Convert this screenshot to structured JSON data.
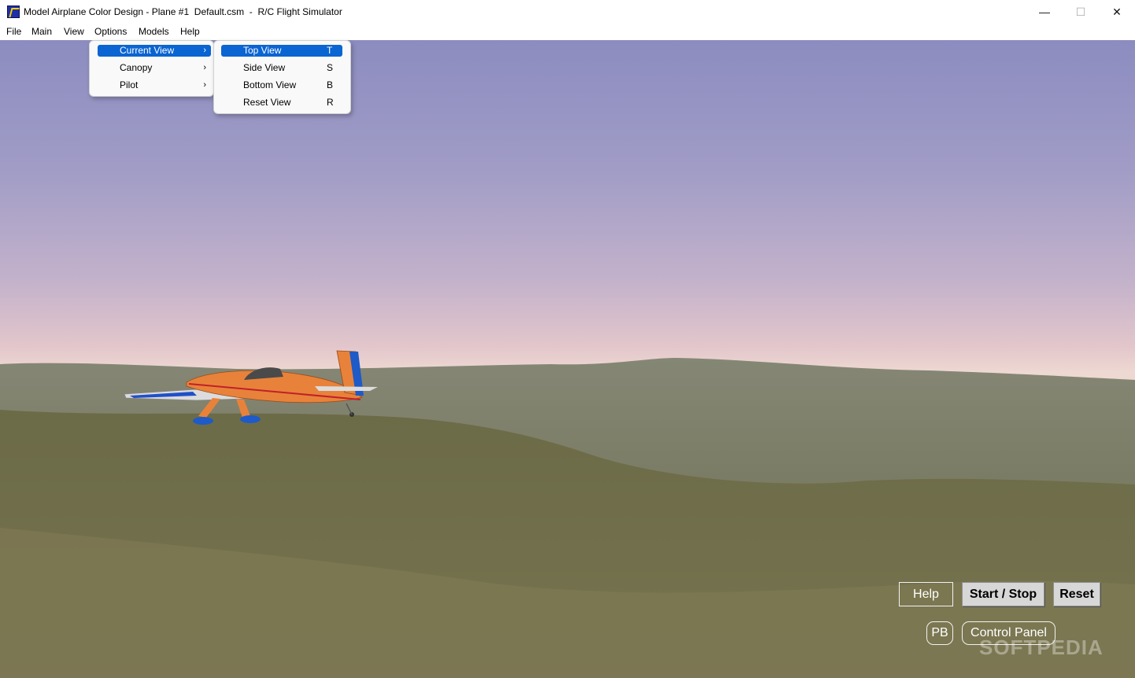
{
  "window": {
    "title": "Model Airplane Color Design - Plane #1  Default.csm  -  R/C Flight Simulator",
    "minimize_glyph": "—",
    "maximize_glyph": "☐",
    "close_glyph": "✕",
    "icon": "app-plane-icon"
  },
  "menubar": {
    "items": [
      "File",
      "Main",
      "View",
      "Options",
      "Models",
      "Help"
    ]
  },
  "options_menu": {
    "items": [
      {
        "label": "Current View",
        "submenu": true,
        "selected": true
      },
      {
        "label": "Canopy",
        "submenu": true,
        "selected": false
      },
      {
        "label": "Pilot",
        "submenu": true,
        "selected": false
      }
    ],
    "arrow_glyph": "›"
  },
  "view_submenu": {
    "items": [
      {
        "label": "Top View",
        "shortcut": "T",
        "selected": true
      },
      {
        "label": "Side View",
        "shortcut": "S",
        "selected": false
      },
      {
        "label": "Bottom View",
        "shortcut": "B",
        "selected": false
      },
      {
        "label": "Reset View",
        "shortcut": "R",
        "selected": false
      }
    ]
  },
  "controls": {
    "help": "Help",
    "start_stop": "Start / Stop",
    "reset": "Reset",
    "pb": "PB",
    "control_panel": "Control Panel"
  },
  "watermark": "SOFTPEDIA",
  "colors": {
    "menu_highlight": "#0a64d2",
    "plane_body": "#e8823a",
    "plane_tail": "#1e5ac8",
    "terrain": "#6b6a45"
  }
}
